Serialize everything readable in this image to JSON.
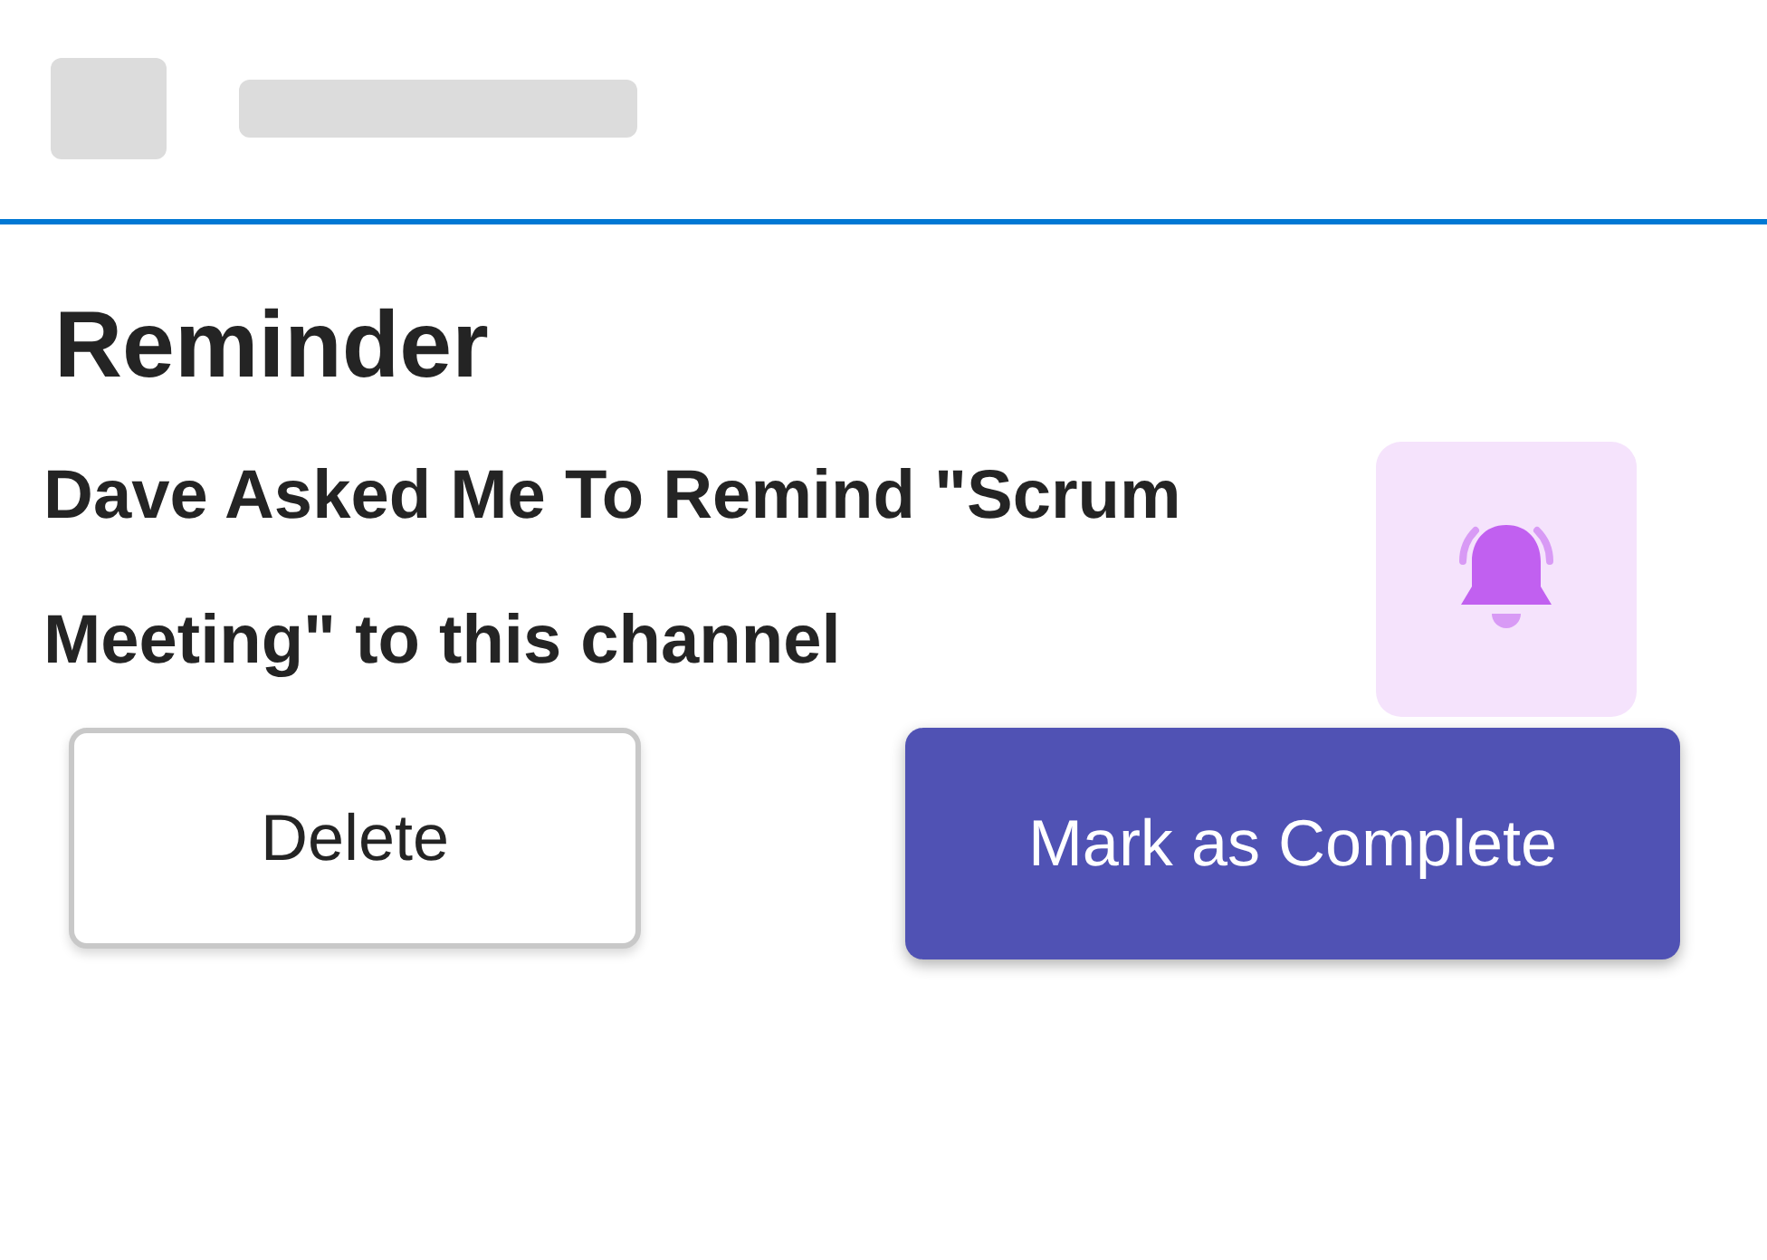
{
  "title": "Reminder",
  "message": "Dave Asked Me To Remind \"Scrum Meeting\" to this channel",
  "buttons": [
    {
      "label": "Delete",
      "kind": "secondary"
    },
    {
      "label": "Mark as Complete",
      "kind": "primary"
    }
  ]
}
